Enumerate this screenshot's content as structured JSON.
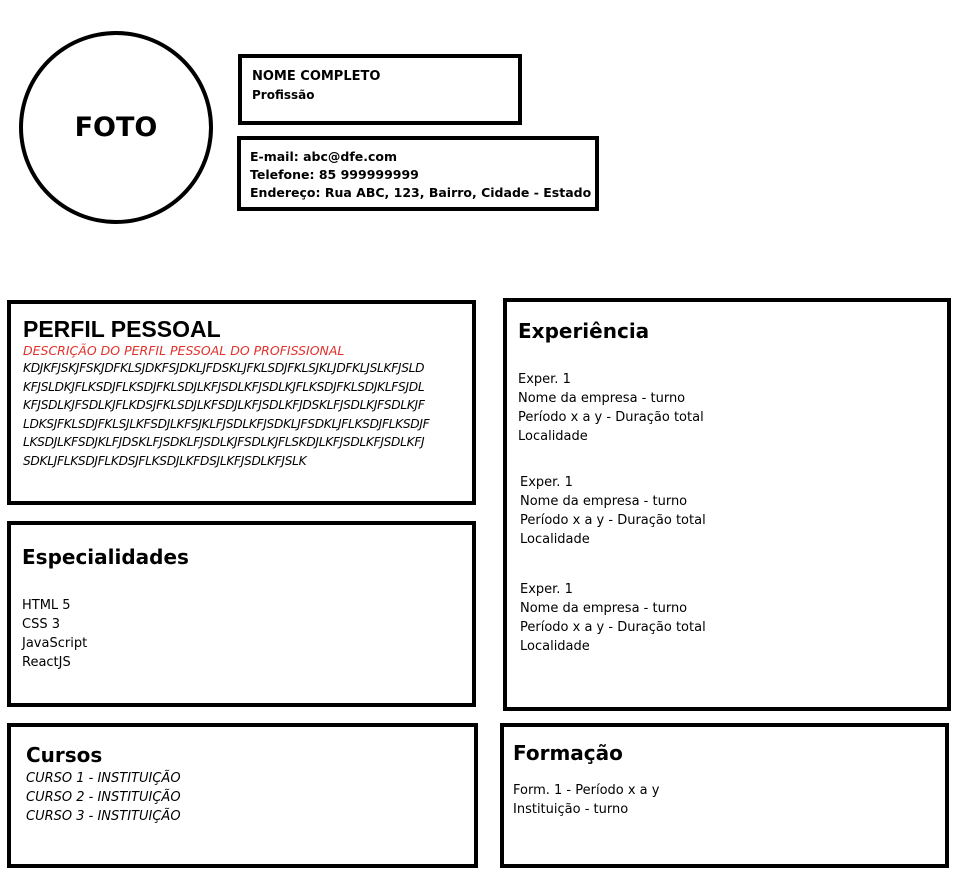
{
  "photo": {
    "label": "FOTO"
  },
  "header": {
    "name": "NOME COMPLETO",
    "profession": "Profissão"
  },
  "contact": {
    "email": "E-mail: abc@dfe.com",
    "phone": "Telefone: 85 999999999",
    "address": "Endereço: Rua ABC, 123, Bairro, Cidade - Estado"
  },
  "profile": {
    "title": "PERFIL PESSOAL",
    "subtitle": "DESCRIÇÃO DO PERFIL PESSOAL DO PROFISSIONAL",
    "lines": [
      "KDJKFJSKJFSKJDFKLSJDKFSJDKLJFDSKLJFKLSDJFKLSJKLJDFKLJSLKFJSLD",
      "KFJSLDKJFLKSDJFLKSDJFKLSDJLKFJSDLKFJSDLKJFLKSDJFKLSDJKLFSJDL",
      "KFJSDLKJFSDLKJFLKDSJFKLSDJLKFSDJLKFJSDLKFJDSKLFJSDLKJFSDLKJF",
      "LDKSJFKLSDJFKLSJLKFSDJLKFSJKLFJSDLKFJSDKLJFSDKLJFLKSDJFLKSDJF",
      "LKSDJLKFSDJKLFJDSKLFJSDKLFJSDLKJFSDLKJFLSKDJLKFJSDLKFJSDLKFJ",
      "SDKLJFLKSDJFLKDSJFLKSDJLKFDSJLKFJSDLKFJSLK"
    ]
  },
  "skills": {
    "title": "Especialidades",
    "items": [
      "HTML 5",
      "CSS 3",
      "JavaScript",
      "ReactJS"
    ]
  },
  "courses": {
    "title": "Cursos",
    "items": [
      "CURSO 1 - INSTITUIÇÃO",
      "CURSO 2 - INSTITUIÇÃO",
      "CURSO 3 - INSTITUIÇÃO"
    ]
  },
  "experience": {
    "title": "Experiência",
    "entries": [
      {
        "label": "Exper. 1",
        "company": "Nome da empresa - turno",
        "period": "Período x a y - Duração total",
        "location": "Localidade"
      },
      {
        "label": "Exper. 1",
        "company": "Nome da empresa - turno",
        "period": "Período x a y - Duração total",
        "location": "Localidade"
      },
      {
        "label": "Exper. 1",
        "company": "Nome da empresa - turno",
        "period": "Período x a y - Duração total",
        "location": "Localidade"
      }
    ]
  },
  "education": {
    "title": "Formação",
    "line1": "Form. 1 - Período x a y",
    "line2": "Instituição - turno"
  }
}
